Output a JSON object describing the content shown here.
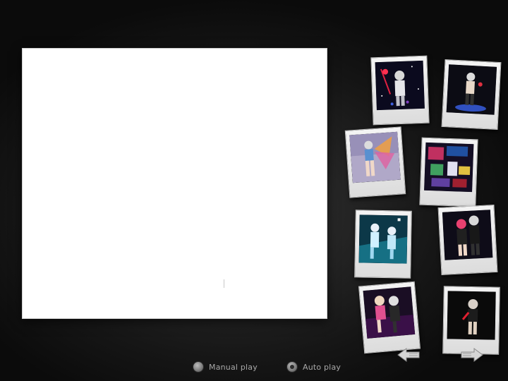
{
  "controls": {
    "manual_label": "Manual play",
    "auto_label": "Auto play",
    "selected_mode": "Auto play"
  },
  "thumbnails": [
    {
      "icon": "photo-thumbnail"
    },
    {
      "icon": "photo-thumbnail"
    },
    {
      "icon": "photo-thumbnail"
    },
    {
      "icon": "photo-thumbnail"
    },
    {
      "icon": "photo-thumbnail"
    },
    {
      "icon": "photo-thumbnail"
    },
    {
      "icon": "photo-thumbnail"
    },
    {
      "icon": "photo-thumbnail"
    }
  ],
  "navigation": {
    "prev_icon": "arrow-left-icon",
    "next_icon": "arrow-right-icon"
  },
  "colors": {
    "background": "#161616",
    "viewer": "#ffffff",
    "polaroid_frame": "#e8e8e8",
    "label_text": "#a8a8a8"
  }
}
